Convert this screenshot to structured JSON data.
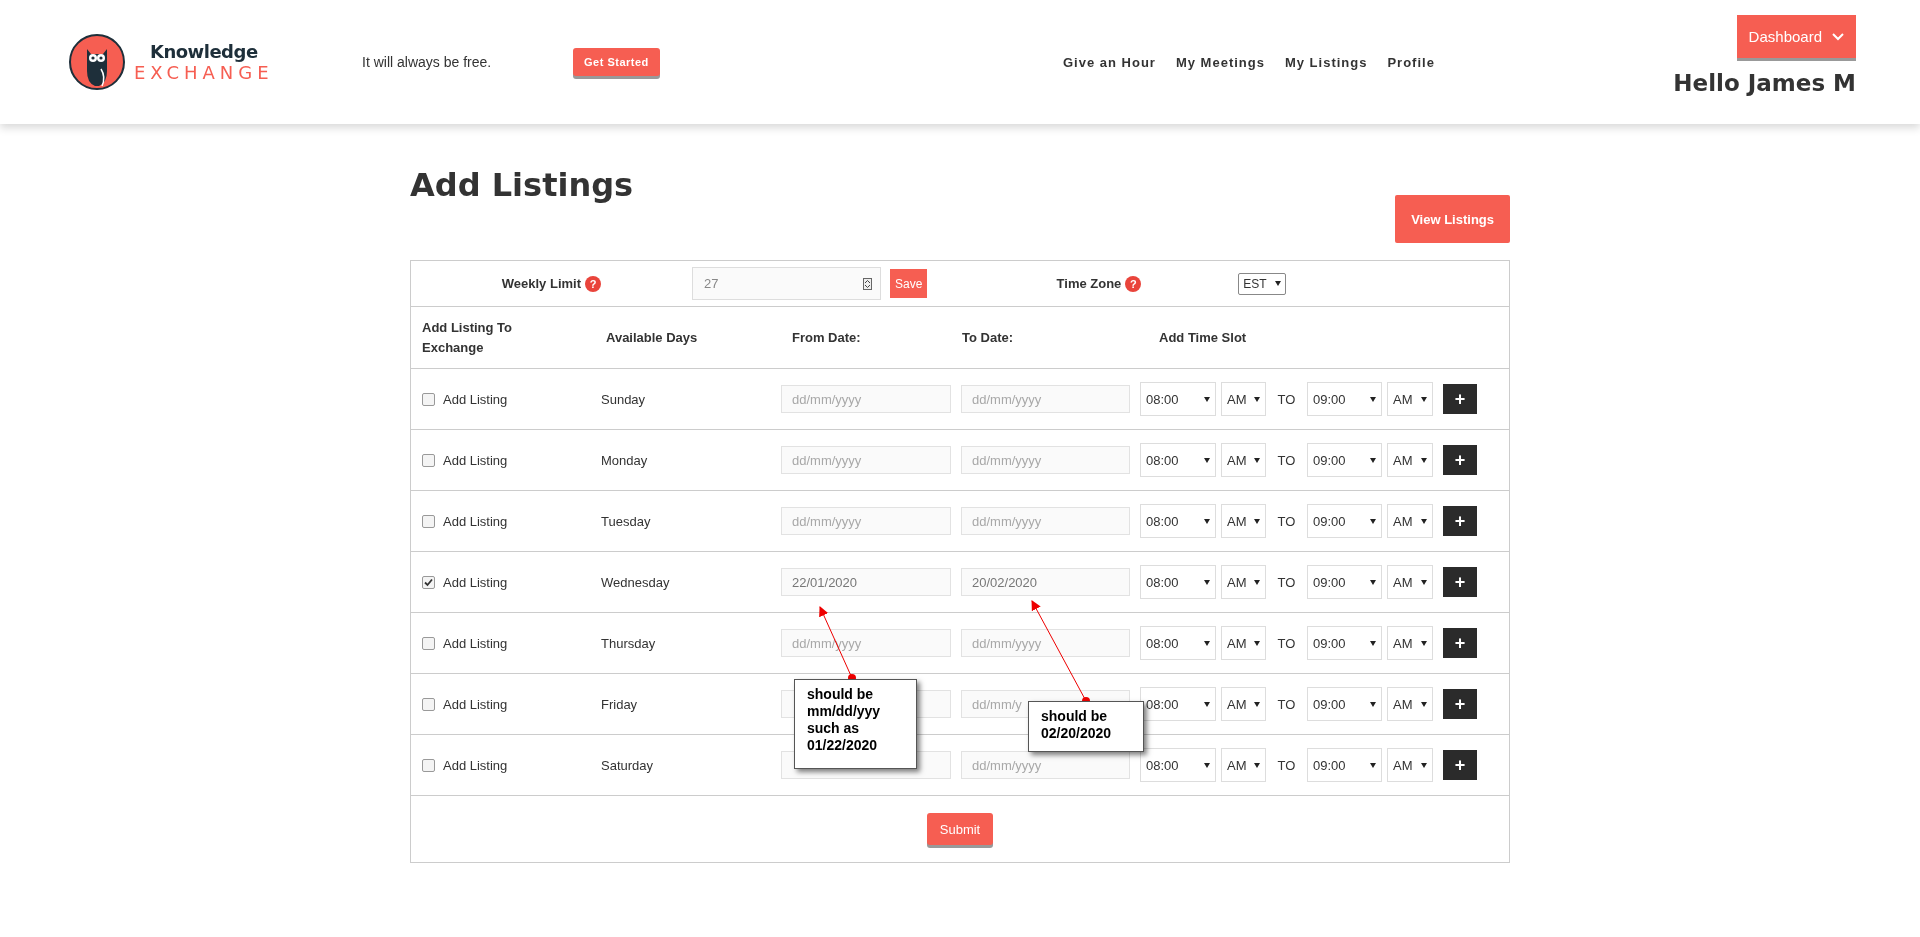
{
  "header": {
    "logo": {
      "top": "Knowledge",
      "bottom": "EXCHANGE"
    },
    "tagline": "It will always be free.",
    "cta": "Get Started",
    "nav": [
      "Give an Hour",
      "My Meetings",
      "My Listings",
      "Profile"
    ],
    "menu_button": "Dashboard",
    "greeting": "Hello James M"
  },
  "page": {
    "title": "Add Listings",
    "view_button": "View Listings"
  },
  "settings": {
    "weekly_limit_label": "Weekly Limit",
    "weekly_limit_help": "?",
    "weekly_limit_value": "27",
    "save": "Save",
    "time_zone_label": "Time Zone",
    "time_zone_help": "?",
    "time_zone": "EST"
  },
  "columns": [
    "Add Listing To Exchange",
    "Available Days",
    "From Date:",
    "To Date:",
    "Add Time Slot"
  ],
  "rows": [
    {
      "label": "Add Listing",
      "checked": false,
      "day": "Sunday",
      "from_date": {
        "placeholder": "dd/mm/yyyy"
      },
      "to_date": {
        "placeholder": "dd/mm/yyyy"
      },
      "start_time": "08:00",
      "start_period": "AM",
      "to_label": "TO",
      "end_time": "09:00",
      "end_period": "AM",
      "add": "+"
    },
    {
      "label": "Add Listing",
      "checked": false,
      "day": "Monday",
      "from_date": {
        "placeholder": "dd/mm/yyyy"
      },
      "to_date": {
        "placeholder": "dd/mm/yyyy"
      },
      "start_time": "08:00",
      "start_period": "AM",
      "to_label": "TO",
      "end_time": "09:00",
      "end_period": "AM",
      "add": "+"
    },
    {
      "label": "Add Listing",
      "checked": false,
      "day": "Tuesday",
      "from_date": {
        "placeholder": "dd/mm/yyyy"
      },
      "to_date": {
        "placeholder": "dd/mm/yyyy"
      },
      "start_time": "08:00",
      "start_period": "AM",
      "to_label": "TO",
      "end_time": "09:00",
      "end_period": "AM",
      "add": "+"
    },
    {
      "label": "Add Listing",
      "checked": true,
      "day": "Wednesday",
      "from_date": {
        "value": "22/01/2020"
      },
      "to_date": {
        "value": "20/02/2020"
      },
      "start_time": "08:00",
      "start_period": "AM",
      "to_label": "TO",
      "end_time": "09:00",
      "end_period": "AM",
      "add": "+"
    },
    {
      "label": "Add Listing",
      "checked": false,
      "day": "Thursday",
      "from_date": {
        "placeholder": "dd/mm/yyyy"
      },
      "to_date": {
        "placeholder": "dd/mm/yyyy"
      },
      "start_time": "08:00",
      "start_period": "AM",
      "to_label": "TO",
      "end_time": "09:00",
      "end_period": "AM",
      "add": "+"
    },
    {
      "label": "Add Listing",
      "checked": false,
      "day": "Friday",
      "from_date": {},
      "to_date": {
        "placeholder": "dd/mm/y"
      },
      "start_time": "08:00",
      "start_period": "AM",
      "to_label": "TO",
      "end_time": "09:00",
      "end_period": "AM",
      "add": "+"
    },
    {
      "label": "Add Listing",
      "checked": false,
      "day": "Saturday",
      "from_date": {},
      "to_date": {
        "placeholder": "dd/mm/yyyy"
      },
      "start_time": "08:00",
      "start_period": "AM",
      "to_label": "TO",
      "end_time": "09:00",
      "end_period": "AM",
      "add": "+"
    }
  ],
  "submit": "Submit",
  "annotations": [
    {
      "text": "should be mm/dd/yyy such as 01/22/2020"
    },
    {
      "text": "should be 02/20/2020"
    }
  ]
}
